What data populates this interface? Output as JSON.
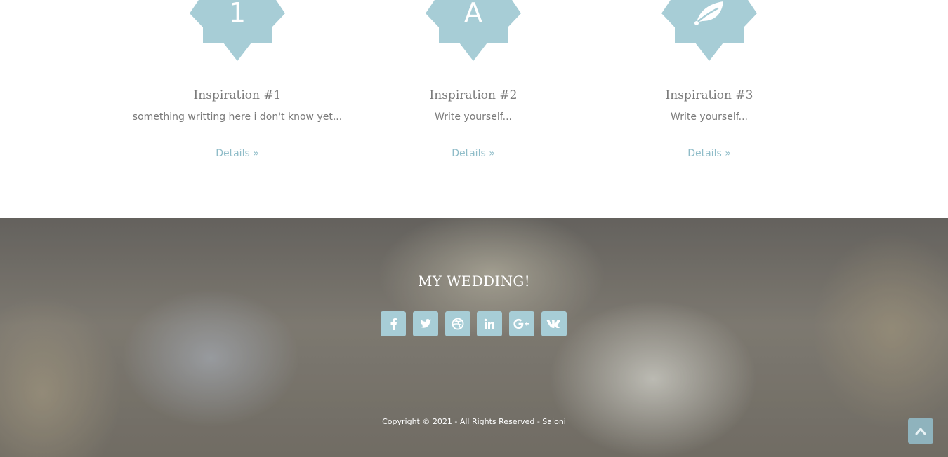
{
  "features": [
    {
      "badge": "1",
      "badge_type": "text",
      "title": "Inspiration #1",
      "description": "something writting here i don't know yet...",
      "link": "Details »"
    },
    {
      "badge": "A",
      "badge_type": "text",
      "title": "Inspiration #2",
      "description": "Write yourself...",
      "link": "Details »"
    },
    {
      "badge": "leaf-icon",
      "badge_type": "icon",
      "title": "Inspiration #3",
      "description": "Write yourself...",
      "link": "Details »"
    }
  ],
  "colors": {
    "accent": "#a7cdd6",
    "link": "#8fbcc8",
    "text": "#7a7a7a"
  },
  "footer": {
    "title": "MY WEDDING!",
    "socials": [
      "facebook-icon",
      "twitter-icon",
      "dribbble-icon",
      "linkedin-icon",
      "google-plus-icon",
      "vk-icon"
    ],
    "copyright": "Copyright © 2021 - All Rights Reserved - Saloni"
  },
  "back_to_top": {
    "icon": "chevron-up-icon"
  }
}
